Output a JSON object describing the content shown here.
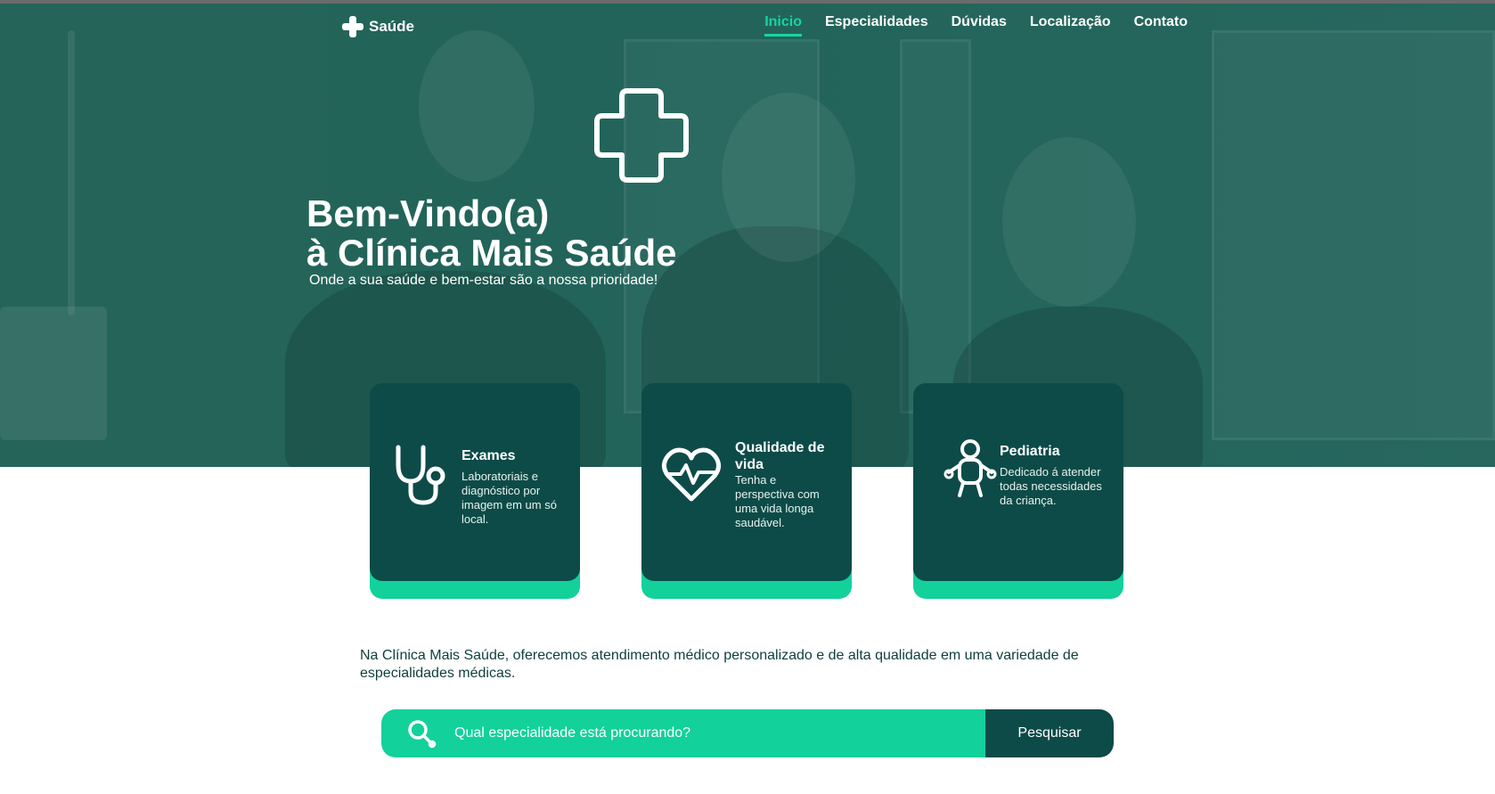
{
  "brand": {
    "name": "Saúde"
  },
  "nav": {
    "items": [
      {
        "label": "Inicio",
        "active": true
      },
      {
        "label": "Especialidades",
        "active": false
      },
      {
        "label": "Dúvidas",
        "active": false
      },
      {
        "label": "Localização",
        "active": false
      },
      {
        "label": "Contato",
        "active": false
      }
    ]
  },
  "hero": {
    "title_line1": "Bem-Vindo(a)",
    "title_line2": "à Clínica Mais Saúde",
    "subtitle": "Onde a sua saúde e bem-estar são a nossa prioridade!"
  },
  "cards": [
    {
      "icon": "stethoscope-icon",
      "title": "Exames",
      "text": "Laboratoriais e diagnóstico por imagem em um só local."
    },
    {
      "icon": "heart-pulse-icon",
      "title": "Qualidade de vida",
      "text": "Tenha e perspectiva com uma vida longa saudável."
    },
    {
      "icon": "baby-icon",
      "title": "Pediatria",
      "text": "Dedicado á atender todas necessidades da criança."
    }
  ],
  "intro": {
    "text": "Na Clínica Mais Saúde, oferecemos atendimento médico personalizado e de alta qualidade em uma variedade de especialidades médicas."
  },
  "search": {
    "placeholder": "Qual especialidade está procurando?",
    "button_label": "Pesquisar"
  },
  "colors": {
    "accent": "#12d19b",
    "dark": "#0d4b48",
    "nav_active": "#19d4a0"
  }
}
